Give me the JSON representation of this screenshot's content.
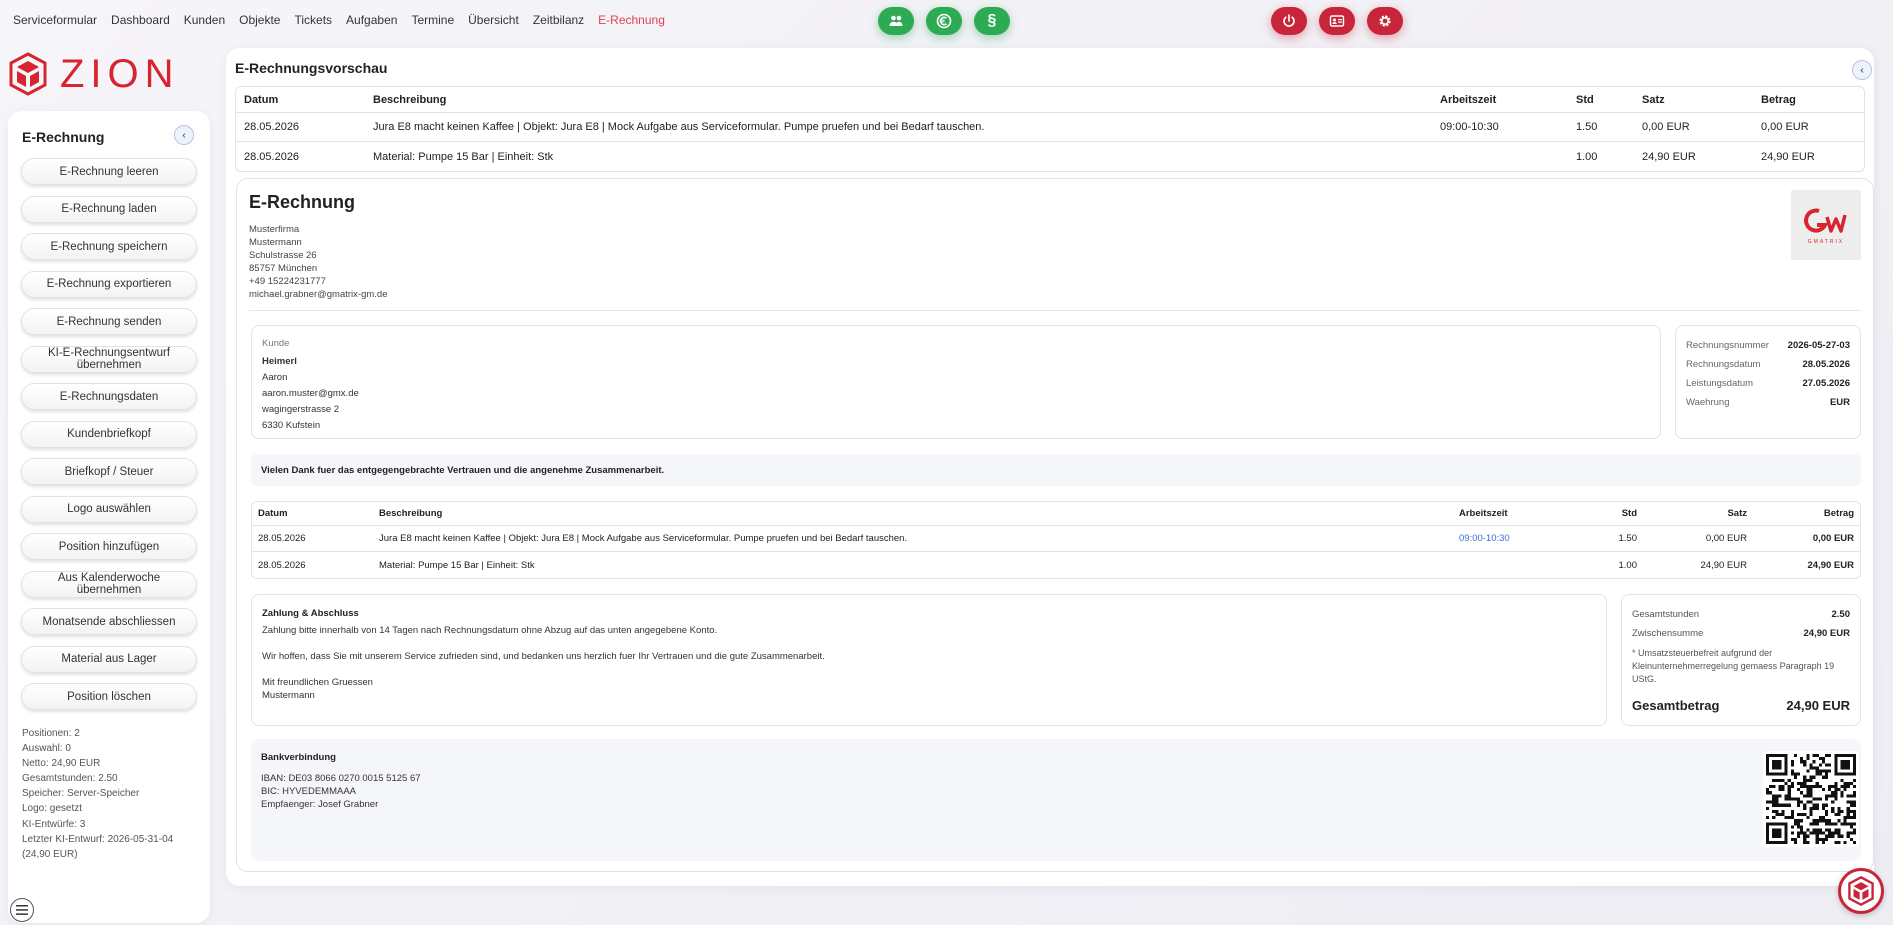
{
  "nav": {
    "links": [
      "Serviceformular",
      "Dashboard",
      "Kunden",
      "Objekte",
      "Tickets",
      "Aufgaben",
      "Termine",
      "Übersicht",
      "Zeitbilanz",
      "E-Rechnung"
    ],
    "active": "E-Rechnung"
  },
  "brand": {
    "name": "ZION",
    "color": "#d7242f"
  },
  "colors": {
    "accent": "#e0414f",
    "green": "#2eaa55",
    "red": "#c8253a",
    "link": "#3b6fd1"
  },
  "icons": {
    "green_buttons": [
      "users-icon",
      "money-icon",
      "paragraph-icon"
    ],
    "red_buttons": [
      "power-icon",
      "id-card-icon",
      "gear-icon"
    ]
  },
  "sidebar": {
    "title": "E-Rechnung",
    "collapse_label": "‹",
    "buttons": [
      "E-Rechnung leeren",
      "E-Rechnung laden",
      "E-Rechnung speichern",
      "E-Rechnung exportieren",
      "E-Rechnung senden",
      "KI-E-Rechnungsentwurf übernehmen",
      "E-Rechnungsdaten",
      "Kundenbriefkopf",
      "Briefkopf / Steuer",
      "Logo auswählen",
      "Position hinzufügen",
      "Aus Kalenderwoche übernehmen",
      "Monatsende abschliessen",
      "Material aus Lager",
      "Position löschen"
    ],
    "stats": [
      "Positionen: 2",
      "Auswahl: 0",
      "Netto: 24,90 EUR",
      "Gesamtstunden: 2.50",
      "Speicher: Server-Speicher",
      "Logo: gesetzt",
      "KI-Entwürfe: 3",
      "Letzter KI-Entwurf: 2026-05-31-04 (24,90 EUR)"
    ]
  },
  "preview": {
    "title": "E-Rechnungsvorschau",
    "collapse_label": "‹",
    "headers": [
      "Datum",
      "Beschreibung",
      "Arbeitszeit",
      "Std",
      "Satz",
      "Betrag"
    ],
    "rows": [
      [
        "28.05.2026",
        "Jura E8 macht keinen Kaffee | Objekt: Jura E8 | Mock Aufgabe aus Serviceformular. Pumpe pruefen und bei Bedarf tauschen.",
        "09:00-10:30",
        "1.50",
        "0,00 EUR",
        "0,00 EUR"
      ],
      [
        "28.05.2026",
        "Material: Pumpe 15 Bar | Einheit: Stk",
        "",
        "1.00",
        "24,90 EUR",
        "24,90 EUR"
      ]
    ]
  },
  "invoice": {
    "title": "E-Rechnung",
    "sender": [
      "Musterfirma",
      "Mustermann",
      "Schulstrasse 26",
      "85757 München",
      "+49 15224231777",
      "michael.grabner@gmatrix-gm.de"
    ],
    "logo_text": "GMATRIX",
    "customer": {
      "label": "Kunde",
      "name": "Heimerl",
      "lines": [
        "Aaron",
        "aaron.muster@gmx.de",
        "wagingerstrasse 2",
        "6330 Kufstein"
      ]
    },
    "meta": [
      {
        "k": "Rechnungsnummer",
        "v": "2026-05-27-03"
      },
      {
        "k": "Rechnungsdatum",
        "v": "28.05.2026"
      },
      {
        "k": "Leistungsdatum",
        "v": "27.05.2026"
      },
      {
        "k": "Waehrung",
        "v": "EUR"
      }
    ],
    "thanks": "Vielen Dank fuer das entgegengebrachte Vertrauen und die angenehme Zusammenarbeit.",
    "headers": [
      "Datum",
      "Beschreibung",
      "Arbeitszeit",
      "Std",
      "Satz",
      "Betrag"
    ],
    "rows": [
      [
        "28.05.2026",
        "Jura E8 macht keinen Kaffee | Objekt: Jura E8 | Mock Aufgabe aus Serviceformular. Pumpe pruefen und bei Bedarf tauschen.",
        "09:00-10:30",
        "1.50",
        "0,00 EUR",
        "0,00 EUR"
      ],
      [
        "28.05.2026",
        "Material: Pumpe 15 Bar | Einheit: Stk",
        "",
        "1.00",
        "24,90 EUR",
        "24,90 EUR"
      ]
    ],
    "payment": {
      "title": "Zahlung & Abschluss",
      "line1": "Zahlung bitte innerhalb von 14 Tagen nach Rechnungsdatum ohne Abzug auf das unten angegebene Konto.",
      "line2": "Wir hoffen, dass Sie mit unserem Service zufrieden sind, und bedanken uns herzlich fuer Ihr Vertrauen und die gute Zusammenarbeit.",
      "greeting": "Mit freundlichen Gruessen",
      "signature": "Mustermann"
    },
    "summary": {
      "hours_label": "Gesamtstunden",
      "hours": "2.50",
      "subtotal_label": "Zwischensumme",
      "subtotal": "24,90 EUR",
      "note": "* Umsatzsteuerbefreit aufgrund der Kleinunternehmerregelung gemaess Paragraph 19 UStG.",
      "total_label": "Gesamtbetrag",
      "total": "24,90 EUR"
    },
    "bank": {
      "title": "Bankverbindung",
      "iban": "IBAN: DE03 8066 0270 0015 5125 67",
      "bic": "BIC: HYVEDEMMAAA",
      "recipient": "Empfaenger: Josef Grabner"
    }
  }
}
